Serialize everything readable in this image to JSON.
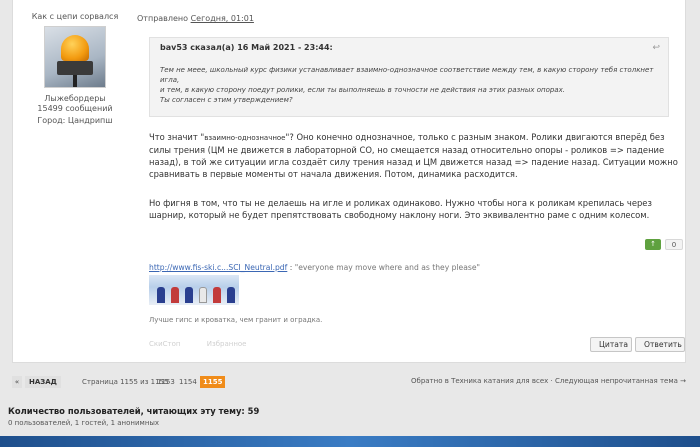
{
  "author": {
    "status": "Как с цепи сорвался",
    "group": "Лыжебордеры",
    "posts": "15499 сообщений",
    "city": "Город: Цандрипш"
  },
  "post": {
    "sent_prefix": "Отправлено",
    "sent_link": "Сегодня, 01:01",
    "quote_header": "bav53 сказал(а) 16 Май 2021 - 23:44:",
    "quote_icon": "↩",
    "quote_line1": "Тем не мееe, школьный курс физики устанавливает взаимно-однозначное соответствие между тем, в какую сторону тебя столкнет игла,",
    "quote_line2": "и тем, в какую сторону поедут ролики, если ты выполняешь в точности не действия на этих разных опорах.",
    "quote_line3": "Ты согласен с этим утверждением?",
    "msg1_start": "Что значит \"",
    "msg1_term": "взаимно-однозначное",
    "msg1_rest": "\"? Оно конечно однозначное, только с разным знаком. Ролики двигаются вперёд без силы трения (ЦМ не движется в лабораторной СО, но смещается назад относительно опоры - роликов => падение назад), в той же ситуации игла создаёт силу трения назад и ЦМ движется назад => падение назад. Ситуации можно сравнивать в первые моменты от начала движения. Потом, динамика расходится.",
    "msg2": "Но фигня в том, что ты не делаешь на игле и роликах одинаково. Нужно чтобы нога к роликам крепилась через шарнир, который не будет препятствовать свободному наклону ноги. Это эквивалентно раме с одним колесом.",
    "vote_up": "↑",
    "vote_count": "0",
    "attach_link": "http://www.fis-ski.c...SCI_Neutral.pdf",
    "attach_sep": " : ",
    "attach_quote": "\"everyone may move where and as they please\"",
    "signature": "Лучше гипс и кроватка, чем гранит и оградка.",
    "ghost_1": "СкиСтоп",
    "ghost_2": "Избранное",
    "btn_quote": "Цитата",
    "btn_reply": "Ответить"
  },
  "pager": {
    "prev_arrow": "«",
    "prev": "НАЗАД",
    "info": "Страница 1155 из 1155",
    "pages": [
      "1153",
      "1154"
    ],
    "current": "1155"
  },
  "nav": {
    "back_links": "Обратно в Техника катания для всех · Следующая непрочитанная тема →"
  },
  "readers": {
    "title": "Количество пользователей, читающих эту тему: 59",
    "detail": "0 пользователей, 1 гостей, 1 анонимных"
  },
  "colors": {
    "accent_orange": "#f08c1a",
    "vote_green": "#5fa13f",
    "link_blue": "#3b67b4"
  }
}
